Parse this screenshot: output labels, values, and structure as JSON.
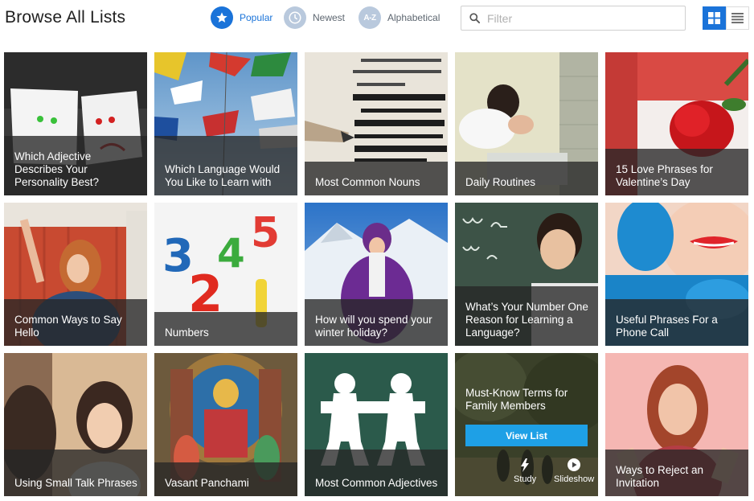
{
  "header": {
    "title": "Browse All Lists",
    "sort_options": [
      {
        "label": "Popular",
        "icon": "star-icon",
        "active": true
      },
      {
        "label": "Newest",
        "icon": "clock-icon",
        "active": false
      },
      {
        "label": "Alphabetical",
        "icon": "az-icon",
        "badge": "A-Z",
        "active": false
      }
    ],
    "filter_placeholder": "Filter",
    "view_modes": [
      "grid",
      "list"
    ]
  },
  "tiles": [
    {
      "caption": "Which Adjective Describes Your Personality Best?"
    },
    {
      "caption": "Which Language Would You Like to Learn with"
    },
    {
      "caption": "Most Common Nouns"
    },
    {
      "caption": "Daily Routines"
    },
    {
      "caption": "15 Love Phrases for Valentine’s Day"
    },
    {
      "caption": "Common Ways to Say Hello"
    },
    {
      "caption": "Numbers"
    },
    {
      "caption": "How will you spend your winter holiday?"
    },
    {
      "caption": "What’s Your Number One Reason for Learning a Language?"
    },
    {
      "caption": "Useful Phrases For a Phone Call"
    },
    {
      "caption": "Using Small Talk Phrases"
    },
    {
      "caption": "Vasant Panchami"
    },
    {
      "caption": "Most Common Adjectives"
    },
    {
      "caption": "Must-Know Terms for Family Members",
      "button": "View List",
      "actions": [
        "Study",
        "Slideshow"
      ]
    },
    {
      "caption": "Ways to Reject an Invitation"
    }
  ],
  "colors": {
    "accent": "#1a73d9",
    "button": "#1ea0e6"
  }
}
